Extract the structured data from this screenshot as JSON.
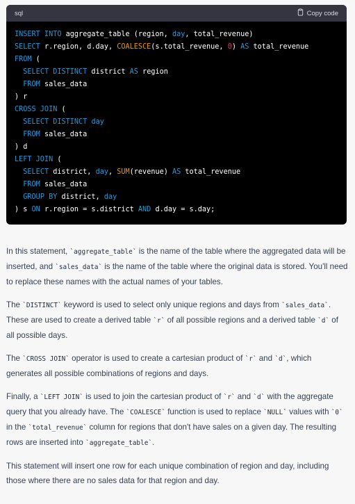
{
  "code_block": {
    "language": "sql",
    "copy_label": "Copy code",
    "copy_icon": "clipboard-icon",
    "lines": [
      [
        {
          "t": "INSERT INTO",
          "c": "kw"
        },
        {
          "t": " aggregate_table (region, "
        },
        {
          "t": "day",
          "c": "kw"
        },
        {
          "t": ", total_revenue)"
        }
      ],
      [
        {
          "t": "SELECT",
          "c": "kw"
        },
        {
          "t": " r.region, d.day, "
        },
        {
          "t": "COALESCE",
          "c": "fn2"
        },
        {
          "t": "(s.total_revenue, "
        },
        {
          "t": "0",
          "c": "num"
        },
        {
          "t": ") "
        },
        {
          "t": "AS",
          "c": "kw"
        },
        {
          "t": " total_revenue"
        }
      ],
      [
        {
          "t": "FROM",
          "c": "kw"
        },
        {
          "t": " ("
        }
      ],
      [
        {
          "t": "  "
        },
        {
          "t": "SELECT DISTINCT",
          "c": "kw"
        },
        {
          "t": " district "
        },
        {
          "t": "AS",
          "c": "kw"
        },
        {
          "t": " region"
        }
      ],
      [
        {
          "t": "  "
        },
        {
          "t": "FROM",
          "c": "kw"
        },
        {
          "t": " sales_data"
        }
      ],
      [
        {
          "t": ") r"
        }
      ],
      [
        {
          "t": "CROSS JOIN",
          "c": "kw"
        },
        {
          "t": " ("
        }
      ],
      [
        {
          "t": "  "
        },
        {
          "t": "SELECT DISTINCT",
          "c": "kw"
        },
        {
          "t": " "
        },
        {
          "t": "day",
          "c": "kw"
        }
      ],
      [
        {
          "t": "  "
        },
        {
          "t": "FROM",
          "c": "kw"
        },
        {
          "t": " sales_data"
        }
      ],
      [
        {
          "t": ") d"
        }
      ],
      [
        {
          "t": "LEFT JOIN",
          "c": "kw"
        },
        {
          "t": " ("
        }
      ],
      [
        {
          "t": "  "
        },
        {
          "t": "SELECT",
          "c": "kw"
        },
        {
          "t": " district, "
        },
        {
          "t": "day",
          "c": "kw"
        },
        {
          "t": ", "
        },
        {
          "t": "SUM",
          "c": "fn2"
        },
        {
          "t": "(revenue) "
        },
        {
          "t": "AS",
          "c": "kw"
        },
        {
          "t": " total_revenue"
        }
      ],
      [
        {
          "t": "  "
        },
        {
          "t": "FROM",
          "c": "kw"
        },
        {
          "t": " sales_data"
        }
      ],
      [
        {
          "t": "  "
        },
        {
          "t": "GROUP BY",
          "c": "kw"
        },
        {
          "t": " district, "
        },
        {
          "t": "day",
          "c": "kw"
        }
      ],
      [
        {
          "t": ") s "
        },
        {
          "t": "ON",
          "c": "kw"
        },
        {
          "t": " r.region = s.district "
        },
        {
          "t": "AND",
          "c": "kw"
        },
        {
          "t": " d.day = s.day;"
        }
      ]
    ]
  },
  "paragraphs": [
    [
      {
        "t": "In this statement, "
      },
      {
        "code": "`aggregate_table`"
      },
      {
        "t": " is the name of the table where the aggregated data will be inserted, and "
      },
      {
        "code": "`sales_data`"
      },
      {
        "t": " is the name of the table where the original data is stored. You'll need to replace these names with the actual names of your tables."
      }
    ],
    [
      {
        "t": "The "
      },
      {
        "code": "`DISTINCT`"
      },
      {
        "t": " keyword is used to select only unique regions and days from "
      },
      {
        "code": "`sales_data`"
      },
      {
        "t": ". These are used to create a derived table "
      },
      {
        "code": "`r`"
      },
      {
        "t": " of all possible regions and a derived table "
      },
      {
        "code": "`d`"
      },
      {
        "t": " of all possible days."
      }
    ],
    [
      {
        "t": "The "
      },
      {
        "code": "`CROSS JOIN`"
      },
      {
        "t": " operator is used to create a cartesian product of "
      },
      {
        "code": "`r`"
      },
      {
        "t": " and "
      },
      {
        "code": "`d`"
      },
      {
        "t": ", which generates all possible combinations of regions and days."
      }
    ],
    [
      {
        "t": "Finally, a "
      },
      {
        "code": "`LEFT JOIN`"
      },
      {
        "t": " is used to join the cartesian product of "
      },
      {
        "code": "`r`"
      },
      {
        "t": " and "
      },
      {
        "code": "`d`"
      },
      {
        "t": " with the aggregate query that you already have. The "
      },
      {
        "code": "`COALESCE`"
      },
      {
        "t": " function is used to replace "
      },
      {
        "code": "`NULL`"
      },
      {
        "t": " values with "
      },
      {
        "code": "`0`"
      },
      {
        "t": " in the "
      },
      {
        "code": "`total_revenue`"
      },
      {
        "t": " column for regions that don't have sales on a given day. The resulting rows are inserted into "
      },
      {
        "code": "`aggregate_table`"
      },
      {
        "t": "."
      }
    ],
    [
      {
        "t": "This statement will insert one row for each unique combination of region and day, including those where there are no sales data for that region and day."
      }
    ]
  ]
}
